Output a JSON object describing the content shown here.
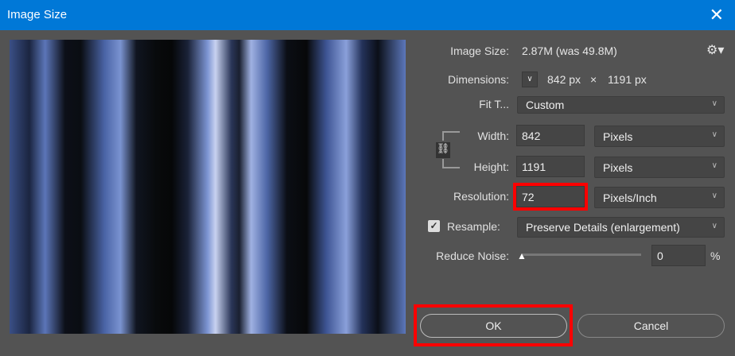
{
  "window": {
    "title": "Image Size",
    "close_icon": "close-icon"
  },
  "image_size": {
    "label": "Image Size:",
    "value": "2.87M (was 49.8M)"
  },
  "dimensions": {
    "label": "Dimensions:",
    "width": "842 px",
    "times": "×",
    "height": "1191 px"
  },
  "fit_to": {
    "label": "Fit T...",
    "value": "Custom"
  },
  "width": {
    "label": "Width:",
    "value": "842",
    "unit": "Pixels"
  },
  "height": {
    "label": "Height:",
    "value": "1191",
    "unit": "Pixels"
  },
  "resolution": {
    "label": "Resolution:",
    "value": "72",
    "unit": "Pixels/Inch"
  },
  "resample": {
    "label": "Resample:",
    "checked": true,
    "value": "Preserve Details (enlargement)"
  },
  "reduce_noise": {
    "label": "Reduce Noise:",
    "value": "0",
    "unit": "%",
    "slider_fraction": 0
  },
  "buttons": {
    "ok": "OK",
    "cancel": "Cancel"
  },
  "colors": {
    "titlebar": "#0078d7",
    "highlight": "#ff0000",
    "background": "#535353"
  }
}
